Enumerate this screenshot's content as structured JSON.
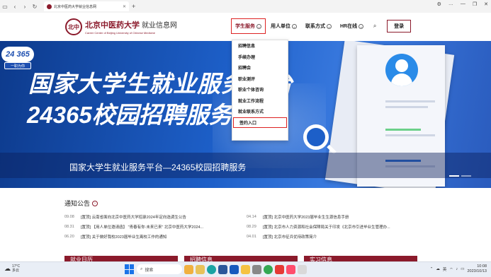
{
  "browser": {
    "tab_title": "北京中医药大学就业信息网",
    "window_controls": [
      "⚙",
      "…",
      "—",
      "❐",
      "✕"
    ]
  },
  "header": {
    "logo_emblem": "北中",
    "school_name": "北京中医药大学",
    "site_name": "就业信息网",
    "english_name": "Career Center of Beijing University of Chinese Medicine",
    "nav": [
      {
        "label": "学生服务"
      },
      {
        "label": "用人单位"
      },
      {
        "label": "联系方式"
      },
      {
        "label": "HR在线"
      }
    ],
    "search_icon": "search-icon",
    "login_label": "登录"
  },
  "dropdown": {
    "items": [
      "招聘信息",
      "手续办理",
      "招聘会",
      "职业测评",
      "职业个体咨询",
      "就业工作流程",
      "就业联系方式",
      "签约入口"
    ]
  },
  "banner": {
    "badge_number": "24 365",
    "badge_sub": "一职为你",
    "headline_line1": "国家大学生就业服务平台",
    "headline_line2": "24365校园招聘服务",
    "caption": "国家大学生就业服务平台—24365校园招聘服务"
  },
  "notices": {
    "title": "通知公告",
    "left": [
      {
        "date": "09.08",
        "text": "[置顶] 云南省面向北京中医药大学招录2024年定向选调生公告"
      },
      {
        "date": "08.31",
        "text": "[置顶] 【用人单位邀请函】 \"青春有你·未来已来\" 北京中医药大学2024..."
      },
      {
        "date": "06.20",
        "text": "[置顶] 关于做好我校2023届毕业生离校工作的通知"
      }
    ],
    "right": [
      {
        "date": "04.14",
        "text": "[置顶] 北京中医药大学2023届毕业生生源信息手册"
      },
      {
        "date": "08.29",
        "text": "[置顶] 北京市人力资源和社会保障局关于印发《北京市引进毕业生管理办..."
      },
      {
        "date": "04.01",
        "text": "[置顶] 北京市征兵优待政策简介"
      }
    ]
  },
  "sections": [
    "就业日历",
    "招聘信息",
    "实习信息"
  ],
  "taskbar": {
    "weather_temp": "17°C",
    "weather_desc": "多云",
    "search_label": "搜索",
    "ime": "英",
    "time": "10:08",
    "date": "2023/10/13"
  },
  "colors": {
    "brand": "#8b1a2b",
    "highlight": "#d22222",
    "banner_blue": "#1d5fc8"
  }
}
